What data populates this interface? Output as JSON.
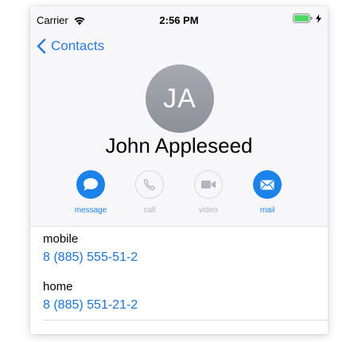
{
  "status_bar": {
    "carrier": "Carrier",
    "time": "2:56 PM",
    "wifi_icon": "wifi-icon",
    "battery_icon": "battery-icon",
    "charging_icon": "bolt-icon"
  },
  "nav": {
    "back_label": "Contacts",
    "back_icon": "chevron-left-icon"
  },
  "contact": {
    "initials": "JA",
    "name": "John Appleseed"
  },
  "actions": [
    {
      "label": "message",
      "icon": "speech-bubble-icon",
      "enabled": true
    },
    {
      "label": "call",
      "icon": "phone-icon",
      "enabled": false
    },
    {
      "label": "video",
      "icon": "video-camera-icon",
      "enabled": false
    },
    {
      "label": "mail",
      "icon": "envelope-icon",
      "enabled": true
    }
  ],
  "fields": [
    {
      "label": "mobile",
      "value": "8 (885) 555-51-2"
    },
    {
      "label": "home",
      "value": "8 (885) 551-21-2"
    }
  ],
  "colors": {
    "accent": "#1a82e8",
    "link": "#1a73d9",
    "disabled": "#b4b4ba",
    "battery": "#4cd964"
  }
}
